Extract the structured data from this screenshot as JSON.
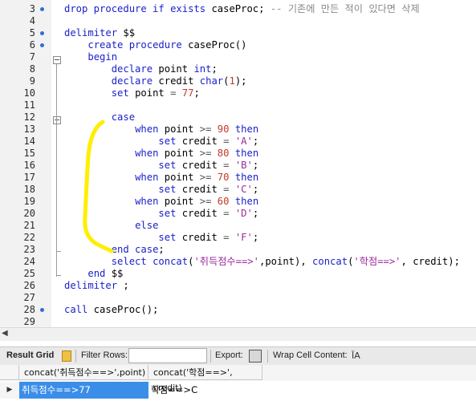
{
  "editor": {
    "lines": [
      {
        "n": "3",
        "bp": true,
        "tokens": [
          [
            "kw",
            "drop procedure if exists "
          ],
          [
            "plain",
            "caseProc; "
          ],
          [
            "cmt",
            "-- 기존에 만든 적이 있다면 삭제"
          ]
        ]
      },
      {
        "n": "4",
        "tokens": []
      },
      {
        "n": "5",
        "bp": true,
        "tokens": [
          [
            "kw",
            "delimiter "
          ],
          [
            "plain",
            "$$"
          ]
        ]
      },
      {
        "n": "6",
        "bp": true,
        "tokens": [
          [
            "plain",
            "    "
          ],
          [
            "kw",
            "create procedure "
          ],
          [
            "plain",
            "caseProc()"
          ]
        ]
      },
      {
        "n": "7",
        "tokens": [
          [
            "plain",
            "    "
          ],
          [
            "kw",
            "begin"
          ]
        ]
      },
      {
        "n": "8",
        "tokens": [
          [
            "plain",
            "        "
          ],
          [
            "kw",
            "declare "
          ],
          [
            "plain",
            "point "
          ],
          [
            "kw",
            "int"
          ],
          [
            "plain",
            ";"
          ]
        ]
      },
      {
        "n": "9",
        "tokens": [
          [
            "plain",
            "        "
          ],
          [
            "kw",
            "declare "
          ],
          [
            "plain",
            "credit "
          ],
          [
            "kw",
            "char"
          ],
          [
            "plain",
            "("
          ],
          [
            "num",
            "1"
          ],
          [
            "plain",
            ");"
          ]
        ]
      },
      {
        "n": "10",
        "tokens": [
          [
            "plain",
            "        "
          ],
          [
            "kw",
            "set "
          ],
          [
            "plain",
            "point "
          ],
          [
            "op",
            "= "
          ],
          [
            "num",
            "77"
          ],
          [
            "plain",
            ";"
          ]
        ]
      },
      {
        "n": "11",
        "tokens": []
      },
      {
        "n": "12",
        "tokens": [
          [
            "plain",
            "        "
          ],
          [
            "kw",
            "case"
          ]
        ]
      },
      {
        "n": "13",
        "tokens": [
          [
            "plain",
            "            "
          ],
          [
            "kw",
            "when "
          ],
          [
            "plain",
            "point "
          ],
          [
            "op",
            ">= "
          ],
          [
            "num",
            "90 "
          ],
          [
            "kw",
            "then"
          ]
        ]
      },
      {
        "n": "14",
        "tokens": [
          [
            "plain",
            "                "
          ],
          [
            "kw",
            "set "
          ],
          [
            "plain",
            "credit "
          ],
          [
            "op",
            "= "
          ],
          [
            "str",
            "'A'"
          ],
          [
            "plain",
            ";"
          ]
        ]
      },
      {
        "n": "15",
        "tokens": [
          [
            "plain",
            "            "
          ],
          [
            "kw",
            "when "
          ],
          [
            "plain",
            "point "
          ],
          [
            "op",
            ">= "
          ],
          [
            "num",
            "80 "
          ],
          [
            "kw",
            "then"
          ]
        ]
      },
      {
        "n": "16",
        "tokens": [
          [
            "plain",
            "                "
          ],
          [
            "kw",
            "set "
          ],
          [
            "plain",
            "credit "
          ],
          [
            "op",
            "= "
          ],
          [
            "str",
            "'B'"
          ],
          [
            "plain",
            ";"
          ]
        ]
      },
      {
        "n": "17",
        "tokens": [
          [
            "plain",
            "            "
          ],
          [
            "kw",
            "when "
          ],
          [
            "plain",
            "point "
          ],
          [
            "op",
            ">= "
          ],
          [
            "num",
            "70 "
          ],
          [
            "kw",
            "then"
          ]
        ]
      },
      {
        "n": "18",
        "tokens": [
          [
            "plain",
            "                "
          ],
          [
            "kw",
            "set "
          ],
          [
            "plain",
            "credit "
          ],
          [
            "op",
            "= "
          ],
          [
            "str",
            "'C'"
          ],
          [
            "plain",
            ";"
          ]
        ]
      },
      {
        "n": "19",
        "tokens": [
          [
            "plain",
            "            "
          ],
          [
            "kw",
            "when "
          ],
          [
            "plain",
            "point "
          ],
          [
            "op",
            ">= "
          ],
          [
            "num",
            "60 "
          ],
          [
            "kw",
            "then"
          ]
        ]
      },
      {
        "n": "20",
        "tokens": [
          [
            "plain",
            "                "
          ],
          [
            "kw",
            "set "
          ],
          [
            "plain",
            "credit "
          ],
          [
            "op",
            "= "
          ],
          [
            "str",
            "'D'"
          ],
          [
            "plain",
            ";"
          ]
        ]
      },
      {
        "n": "21",
        "tokens": [
          [
            "plain",
            "            "
          ],
          [
            "kw",
            "else"
          ]
        ]
      },
      {
        "n": "22",
        "tokens": [
          [
            "plain",
            "                "
          ],
          [
            "kw",
            "set "
          ],
          [
            "plain",
            "credit "
          ],
          [
            "op",
            "= "
          ],
          [
            "str",
            "'F'"
          ],
          [
            "plain",
            ";"
          ]
        ]
      },
      {
        "n": "23",
        "tokens": [
          [
            "plain",
            "        "
          ],
          [
            "kw",
            "end case"
          ],
          [
            "plain",
            ";"
          ]
        ]
      },
      {
        "n": "24",
        "tokens": [
          [
            "plain",
            "        "
          ],
          [
            "kw",
            "select concat"
          ],
          [
            "plain",
            "("
          ],
          [
            "str",
            "'취득점수==>'"
          ],
          [
            "plain",
            ",point), "
          ],
          [
            "kw",
            "concat"
          ],
          [
            "plain",
            "("
          ],
          [
            "str",
            "'학점==>'"
          ],
          [
            "plain",
            ", credit);"
          ]
        ]
      },
      {
        "n": "25",
        "tokens": [
          [
            "plain",
            "    "
          ],
          [
            "kw",
            "end "
          ],
          [
            "plain",
            "$$"
          ]
        ]
      },
      {
        "n": "26",
        "tokens": [
          [
            "kw",
            "delimiter "
          ],
          [
            "plain",
            ";"
          ]
        ]
      },
      {
        "n": "27",
        "tokens": []
      },
      {
        "n": "28",
        "bp": true,
        "tokens": [
          [
            "kw",
            "call "
          ],
          [
            "plain",
            "caseProc();"
          ]
        ]
      },
      {
        "n": "29",
        "tokens": []
      }
    ]
  },
  "toolbar": {
    "result_grid_label": "Result Grid",
    "filter_rows_label": "Filter Rows:",
    "filter_rows_value": "",
    "export_label": "Export:",
    "wrap_label": "Wrap Cell Content:"
  },
  "grid": {
    "columns": [
      "concat('취득점수==>',point)",
      "concat('학점==>', credit)"
    ],
    "rows": [
      [
        "취득점수==>77",
        "학점==>C"
      ]
    ]
  },
  "colors": {
    "keyword": "#1a22c8",
    "string": "#9c2a9c",
    "number": "#c0392b",
    "comment": "#8a8a8a",
    "selection": "#3b8ee8",
    "highlight": "#ffee00"
  }
}
